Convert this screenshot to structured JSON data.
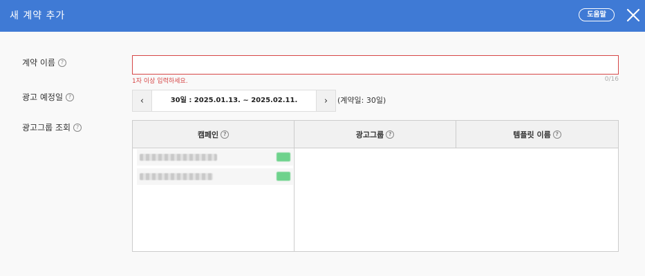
{
  "header": {
    "title": "새 계약 추가",
    "help_label": "도움말",
    "colors": {
      "background": "#3f7ad5",
      "text": "#ffffff"
    }
  },
  "form": {
    "contract_name": {
      "label": "계약 이름",
      "value": "",
      "error": "1자 이상 입력하세요.",
      "counter": "0/16"
    },
    "schedule": {
      "label": "광고 예정일",
      "range_text": "30일 : 2025.01.13. ~ 2025.02.11.",
      "note": "(계약일: 30일)"
    },
    "adgroup_lookup": {
      "label": "광고그룹 조회",
      "columns": {
        "campaign": "캠페인",
        "adgroup": "광고그룹",
        "template": "템플릿 이름"
      }
    }
  },
  "colors": {
    "error": "#d64545"
  }
}
